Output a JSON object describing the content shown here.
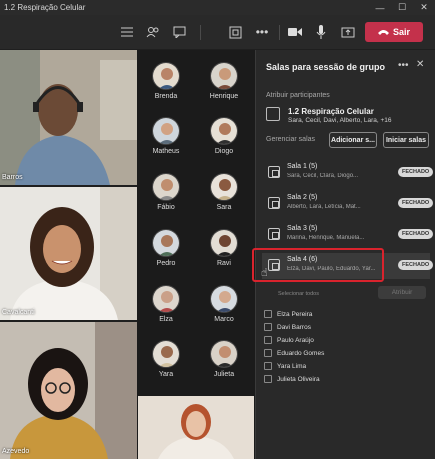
{
  "window": {
    "title": "1.2 Respiração Celular"
  },
  "toolbar": {
    "leave_label": "Sair"
  },
  "videos": [
    {
      "name": "Barros"
    },
    {
      "name": "Cavalcanti"
    },
    {
      "name": "Azevedo"
    }
  ],
  "participants": [
    "Brenda",
    "Henrique",
    "Matheus",
    "Diogo",
    "Fábio",
    "Sara",
    "Pedro",
    "Ravi",
    "Elza",
    "Marco",
    "Yara",
    "Julieta"
  ],
  "panel": {
    "title": "Salas para sessão de grupo",
    "assign_label": "Atribuir participantes",
    "assign_title": "1.2 Respiração Celular",
    "assign_members": "Sara, Cecil, Davi, Alberto, Lara, +16",
    "manage_label": "Gerenciar salas",
    "add_rooms_label": "Adicionar s...",
    "start_rooms_label": "Iniciar salas",
    "rooms": [
      {
        "name": "Sala 1 (5)",
        "members": "Sara, Cecil, Clara, Diogo...",
        "status": "FECHADO"
      },
      {
        "name": "Sala 2 (5)",
        "members": "Alberto, Lara, Letícia, Mat...",
        "status": "FECHADO"
      },
      {
        "name": "Sala 3 (5)",
        "members": "Marina, Henrique, Manuela...",
        "status": "FECHADO"
      },
      {
        "name": "Sala 4 (6)",
        "members": "Elza, Davi, Paulo, Eduardo, Yar...",
        "status": "FECHADO"
      }
    ],
    "select_all_label": "Selecionar todos",
    "assign_button_label": "Atribuir",
    "members": [
      "Elza Pereira",
      "Davi Barros",
      "Paulo Araújo",
      "Eduardo Gomes",
      "Yara Lima",
      "Julieta Oliveira"
    ]
  }
}
